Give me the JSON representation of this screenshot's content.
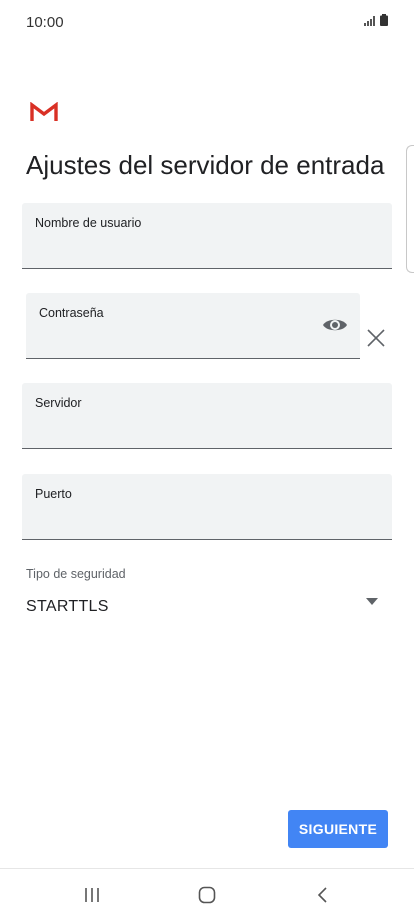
{
  "status_bar": {
    "time": "10:00",
    "signal_icon": "signal-bars-icon",
    "battery_icon": "battery-icon"
  },
  "app": {
    "logo_icon": "gmail-logo-icon",
    "brand_color": "#d93025",
    "accent_color": "#4285f4"
  },
  "header": {
    "title": "Ajustes del servidor de entrada"
  },
  "form": {
    "username": {
      "label": "Nombre de usuario",
      "value": ""
    },
    "password": {
      "label": "Contraseña",
      "value": "",
      "show_icon": "eye-icon",
      "clear_icon": "close-icon"
    },
    "server": {
      "label": "Servidor",
      "value": ""
    },
    "port": {
      "label": "Puerto",
      "value": ""
    },
    "security": {
      "label": "Tipo de seguridad",
      "value": "STARTTLS",
      "dropdown_icon": "caret-down-icon"
    }
  },
  "actions": {
    "next_label": "SIGUIENTE"
  },
  "nav_bar": {
    "recents_icon": "recents-icon",
    "home_icon": "home-icon",
    "back_icon": "back-icon"
  }
}
